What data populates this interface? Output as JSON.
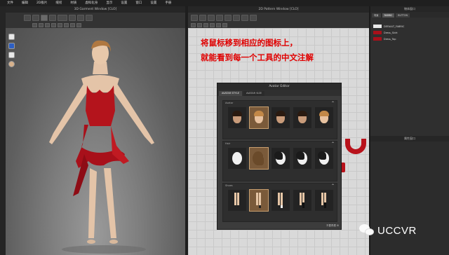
{
  "menu": [
    "文件",
    "编辑",
    "2D板片",
    "缝纫",
    "材质",
    "虚拟化身",
    "显示",
    "设置",
    "窗口",
    "设置",
    "手册"
  ],
  "window3d": {
    "title": "3D Garment Window [CLO]"
  },
  "window2d": {
    "title": "2D Pattern Window [CLO]"
  },
  "annotation": {
    "line1": "将鼠标移到相应的图标上，",
    "line2": "就能看到每一个工具的中文注解"
  },
  "avatar_editor": {
    "title": "Avatar Editor",
    "tabs": [
      "AVATAR STYLE",
      "AVATAR SIZE"
    ],
    "sections": [
      {
        "label": "Avatar",
        "count": 5
      },
      {
        "label": "Hair",
        "count": 5
      },
      {
        "label": "Shoes",
        "count": 5
      }
    ],
    "footer": "不要再看 ⊞"
  },
  "right_panel": {
    "title": "物体窗口",
    "tabs": [
      "场景",
      "FABRIC",
      "BUTTON"
    ],
    "fabrics": [
      {
        "name": "DEFAULT_FABRIC",
        "color": "#e8e8e8"
      },
      {
        "name": "Dress_Skirt",
        "color": "#a8101a"
      },
      {
        "name": "Dress_Top",
        "color": "#a8101a"
      }
    ],
    "lower_title": "属性窗口"
  },
  "watermark": {
    "text": "UCCVR"
  },
  "colors": {
    "annotation": "#e00000",
    "fabric_red": "#a8101a",
    "background": "#2b2b2b"
  }
}
